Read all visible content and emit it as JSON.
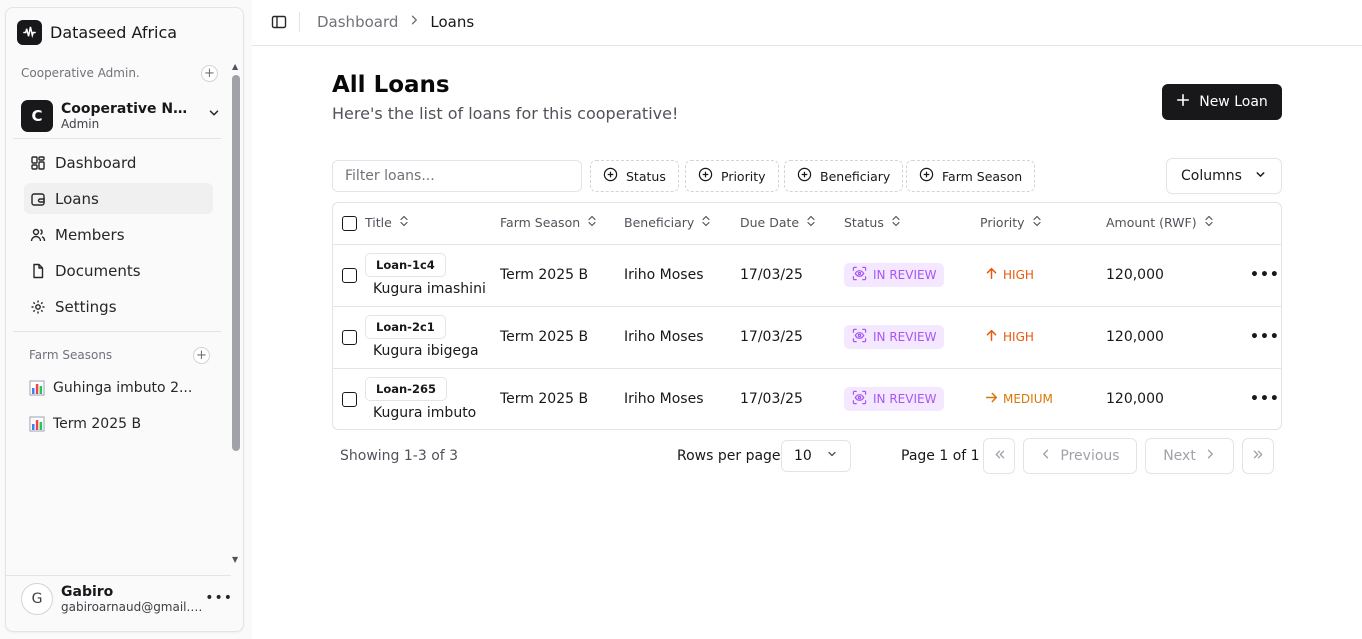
{
  "brand": {
    "name": "Dataseed Africa"
  },
  "sidebar": {
    "coop_group_label": "Cooperative Admin.",
    "coop": {
      "initial": "C",
      "name": "Cooperative Ngo...",
      "role": "Admin"
    },
    "nav": [
      {
        "label": "Dashboard",
        "icon": "layout-grid-icon"
      },
      {
        "label": "Loans",
        "icon": "wallet-icon",
        "active": true
      },
      {
        "label": "Members",
        "icon": "users-icon"
      },
      {
        "label": "Documents",
        "icon": "file-icon"
      },
      {
        "label": "Settings",
        "icon": "gear-icon"
      }
    ],
    "seasons_label": "Farm Seasons",
    "seasons": [
      {
        "label": "Guhinga imbuto 2...",
        "icon": "bar-chart-icon"
      },
      {
        "label": "Term 2025 B",
        "icon": "bar-chart-icon"
      }
    ],
    "user": {
      "initial": "G",
      "name": "Gabiro",
      "email": "gabiroarnaud@gmail.co..."
    }
  },
  "breadcrumb": {
    "parent": "Dashboard",
    "current": "Loans"
  },
  "page": {
    "title": "All Loans",
    "subtitle": "Here's the list of loans for this cooperative!",
    "new_button": "New Loan"
  },
  "filters": {
    "placeholder": "Filter loans...",
    "facets": [
      "Status",
      "Priority",
      "Beneficiary",
      "Farm Season"
    ],
    "columns_button": "Columns"
  },
  "table": {
    "headers": [
      "Title",
      "Farm Season",
      "Beneficiary",
      "Due Date",
      "Status",
      "Priority",
      "Amount (RWF)"
    ],
    "rows": [
      {
        "id": "Loan-1c4",
        "title": "Kugura imashini",
        "season": "Term 2025 B",
        "beneficiary": "Iriho Moses",
        "due": "17/03/25",
        "status": "IN REVIEW",
        "priority": "HIGH",
        "amount": "120,000"
      },
      {
        "id": "Loan-2c1",
        "title": "Kugura ibigega",
        "season": "Term 2025 B",
        "beneficiary": "Iriho Moses",
        "due": "17/03/25",
        "status": "IN REVIEW",
        "priority": "HIGH",
        "amount": "120,000"
      },
      {
        "id": "Loan-265",
        "title": "Kugura imbuto",
        "season": "Term 2025 B",
        "beneficiary": "Iriho Moses",
        "due": "17/03/25",
        "status": "IN REVIEW",
        "priority": "MEDIUM",
        "amount": "120,000"
      }
    ]
  },
  "pagination": {
    "showing": "Showing 1-3 of 3",
    "rows_per_page_label": "Rows per page",
    "rows_per_page": "10",
    "page_info": "Page 1 of 1",
    "previous": "Previous",
    "next": "Next"
  },
  "colors": {
    "accent": "#18181b",
    "status_purple": "#a855f7",
    "priority_high": "#ea580c",
    "priority_medium": "#d97706"
  }
}
